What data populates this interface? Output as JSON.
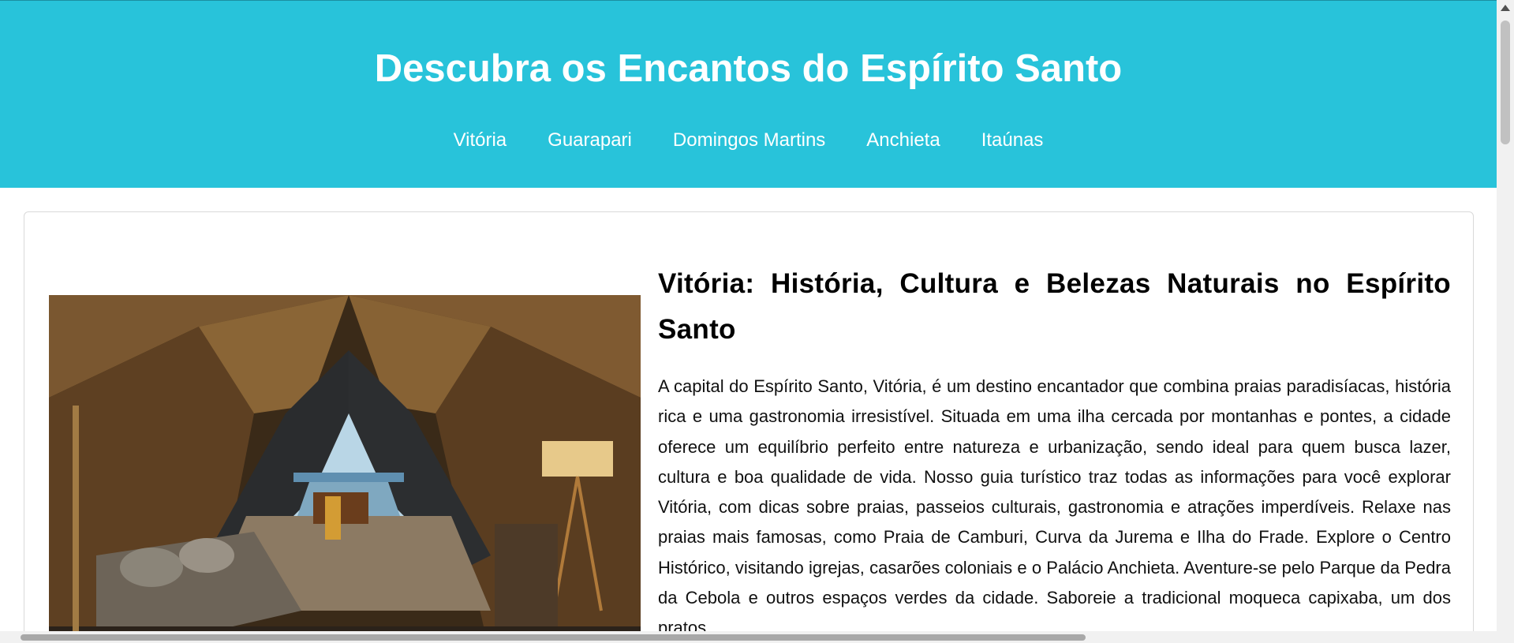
{
  "header": {
    "title": "Descubra os Encantos do Espírito Santo",
    "background": "#28c3da"
  },
  "nav": {
    "items": [
      {
        "label": "Vitória"
      },
      {
        "label": "Guarapari"
      },
      {
        "label": "Domingos Martins"
      },
      {
        "label": "Anchieta"
      },
      {
        "label": "Itaúnas"
      }
    ]
  },
  "article": {
    "image_description_icon": "photo",
    "heading": "Vitória: História, Cultura e Belezas Naturais no Espírito Santo",
    "body": "A capital do Espírito Santo, Vitória, é um destino encantador que combina praias paradisíacas, história rica e uma gastronomia irresistível. Situada em uma ilha cercada por montanhas e pontes, a cidade oferece um equilíbrio perfeito entre natureza e urbanização, sendo ideal para quem busca lazer, cultura e boa qualidade de vida. Nosso guia turístico traz todas as informações para você explorar Vitória, com dicas sobre praias, passeios culturais, gastronomia e atrações imperdíveis. Relaxe nas praias mais famosas, como Praia de Camburi, Curva da Jurema e Ilha do Frade. Explore o Centro Histórico, visitando igrejas, casarões coloniais e o Palácio Anchieta. Aventure-se pelo Parque da Pedra da Cebola e outros espaços verdes da cidade. Saboreie a tradicional moqueca capixaba, um dos pratos"
  }
}
